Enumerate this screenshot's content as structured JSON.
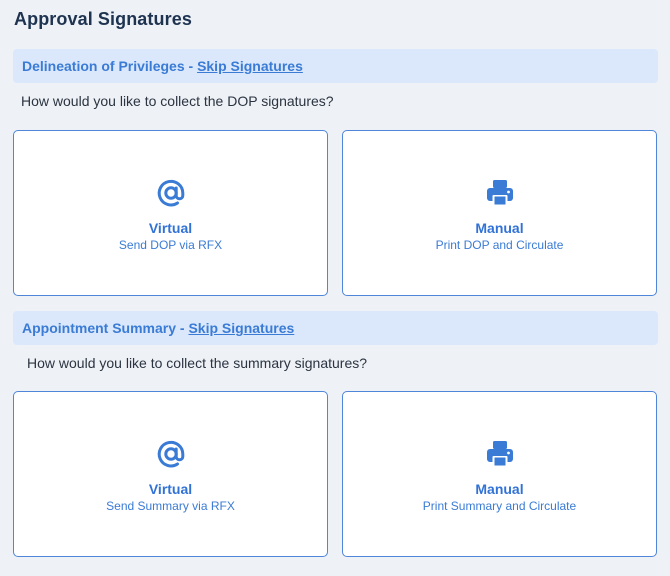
{
  "page": {
    "title": "Approval Signatures"
  },
  "sections": [
    {
      "title": "Delineation of Privileges",
      "separator": " - ",
      "skip_label": "Skip Signatures",
      "question": "How would you like to collect the DOP signatures?",
      "options": [
        {
          "icon": "at-sign-icon",
          "label": "Virtual",
          "sublabel": "Send DOP via RFX"
        },
        {
          "icon": "printer-icon",
          "label": "Manual",
          "sublabel": "Print DOP and Circulate"
        }
      ]
    },
    {
      "title": "Appointment Summary",
      "separator": " - ",
      "skip_label": "Skip Signatures",
      "question": "How would you like to collect the summary signatures?",
      "options": [
        {
          "icon": "at-sign-icon",
          "label": "Virtual",
          "sublabel": "Send Summary via RFX"
        },
        {
          "icon": "printer-icon",
          "label": "Manual",
          "sublabel": "Print Summary and Circulate"
        }
      ]
    }
  ],
  "colors": {
    "accent": "#3a7bd5",
    "section_bg": "#dbe8fb",
    "page_bg": "#eef1f6",
    "card_border": "#4f86d9",
    "title": "#1e3350"
  }
}
